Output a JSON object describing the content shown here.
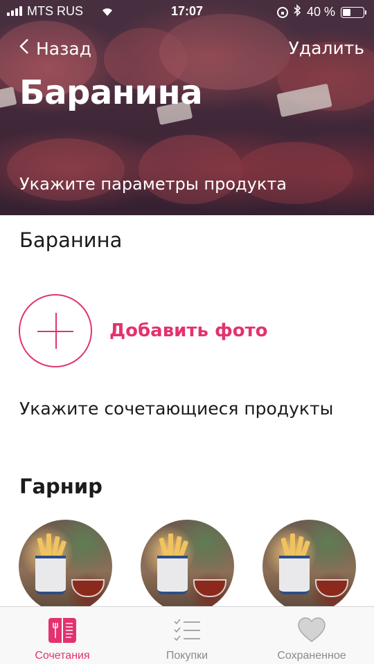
{
  "colors": {
    "accent": "#e3326f",
    "tab_inactive": "#8a8a8a",
    "text": "#1b1b1b"
  },
  "status_bar": {
    "carrier": "MTS RUS",
    "time": "17:07",
    "battery": "40 %",
    "battery_level": 0.4
  },
  "nav": {
    "back_label": "Назад",
    "delete_label": "Удалить"
  },
  "header": {
    "title": "Баранина",
    "subtitle": "Укажите параметры продукта"
  },
  "form": {
    "name_value": "Баранина",
    "add_photo_label": "Добавить фото",
    "pairs_hint": "Укажите сочетающиеся продукты"
  },
  "section": {
    "title": "Гарнир",
    "items": [
      {
        "icon": "fries-photo"
      },
      {
        "icon": "fries-photo"
      },
      {
        "icon": "fries-photo"
      }
    ]
  },
  "tabbar": {
    "tabs": [
      {
        "label": "Сочетания",
        "icon": "book-icon",
        "active": true
      },
      {
        "label": "Покупки",
        "icon": "checklist-icon",
        "active": false
      },
      {
        "label": "Сохраненное",
        "icon": "heart-icon",
        "active": false
      }
    ]
  }
}
